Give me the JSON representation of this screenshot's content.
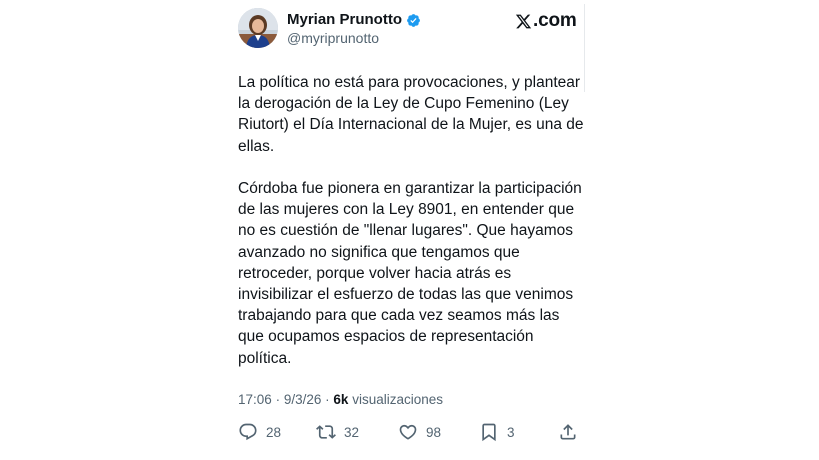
{
  "author": {
    "display_name": "Myrian Prunotto",
    "handle": "@myriprunotto",
    "verified": true,
    "verified_color": "#1d9bf0"
  },
  "brand": {
    "icon": "x-logo-icon",
    "label": ".com"
  },
  "tweet": {
    "paragraphs": [
      "La política no está para provocaciones, y plantear la derogación de la Ley de Cupo Femenino (Ley Riutort) el Día Internacional de la Mujer, es una de ellas.",
      "Córdoba fue pionera en garantizar la participación de las mujeres con la Ley 8901, en entender que no es cuestión de \"llenar lugares\". Que hayamos avanzado no significa que tengamos que retroceder, porque volver hacia atrás es invisibilizar el esfuerzo de todas las que venimos trabajando para que cada vez seamos más las que ocupamos espacios de representación política."
    ],
    "time": "17:06",
    "separator": "·",
    "date": "9/3/26",
    "views_count": "6k",
    "views_label": "visualizaciones"
  },
  "actions": {
    "reply": {
      "icon": "reply-icon",
      "count": "28"
    },
    "retweet": {
      "icon": "retweet-icon",
      "count": "32"
    },
    "like": {
      "icon": "heart-icon",
      "count": "98"
    },
    "bookmark": {
      "icon": "bookmark-icon",
      "count": "3"
    },
    "share": {
      "icon": "share-icon"
    }
  },
  "colors": {
    "text_primary": "#0f1419",
    "text_secondary": "#536471",
    "verified_blue": "#1d9bf0"
  }
}
